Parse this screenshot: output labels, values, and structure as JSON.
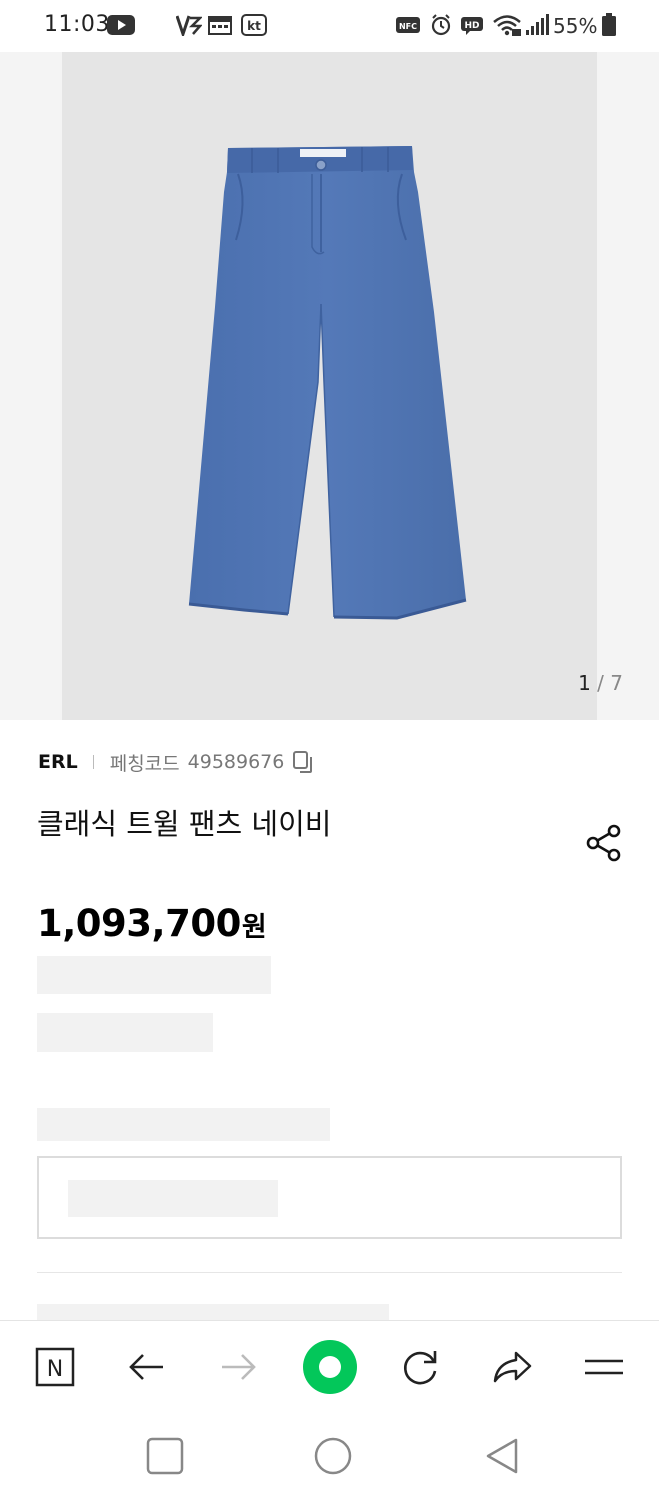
{
  "status_bar": {
    "time": "11:03",
    "battery_percent": "55%",
    "icons": [
      "youtube-icon",
      "v3-icon",
      "calendar-icon",
      "kt-icon",
      "nfc-icon",
      "alarm-icon",
      "hd-icon",
      "wifi-icon",
      "signal-icon",
      "battery-icon"
    ],
    "kt_label": "kt",
    "nfc_label": "NFC",
    "hd_label": "HD"
  },
  "gallery": {
    "current": "1",
    "separator": "/",
    "total": "7",
    "image_icon": "blue-wide-trousers",
    "pants_color": "#4f75b3"
  },
  "product": {
    "brand": "ERL",
    "code_label": "페칭코드",
    "code_value": "49589676",
    "title": "클래식 트윌 팬츠 네이비",
    "price": "1,093,700",
    "price_unit": "원"
  },
  "toolbar": {
    "n_label": "N",
    "accent": "#03c75a",
    "icons": [
      "naver-n-icon",
      "back-arrow-icon",
      "forward-arrow-icon",
      "green-dot-icon",
      "refresh-icon",
      "share-arrow-icon",
      "menu-icon"
    ]
  },
  "navbar": {
    "icons": [
      "recents-icon",
      "home-icon",
      "back-icon"
    ]
  }
}
